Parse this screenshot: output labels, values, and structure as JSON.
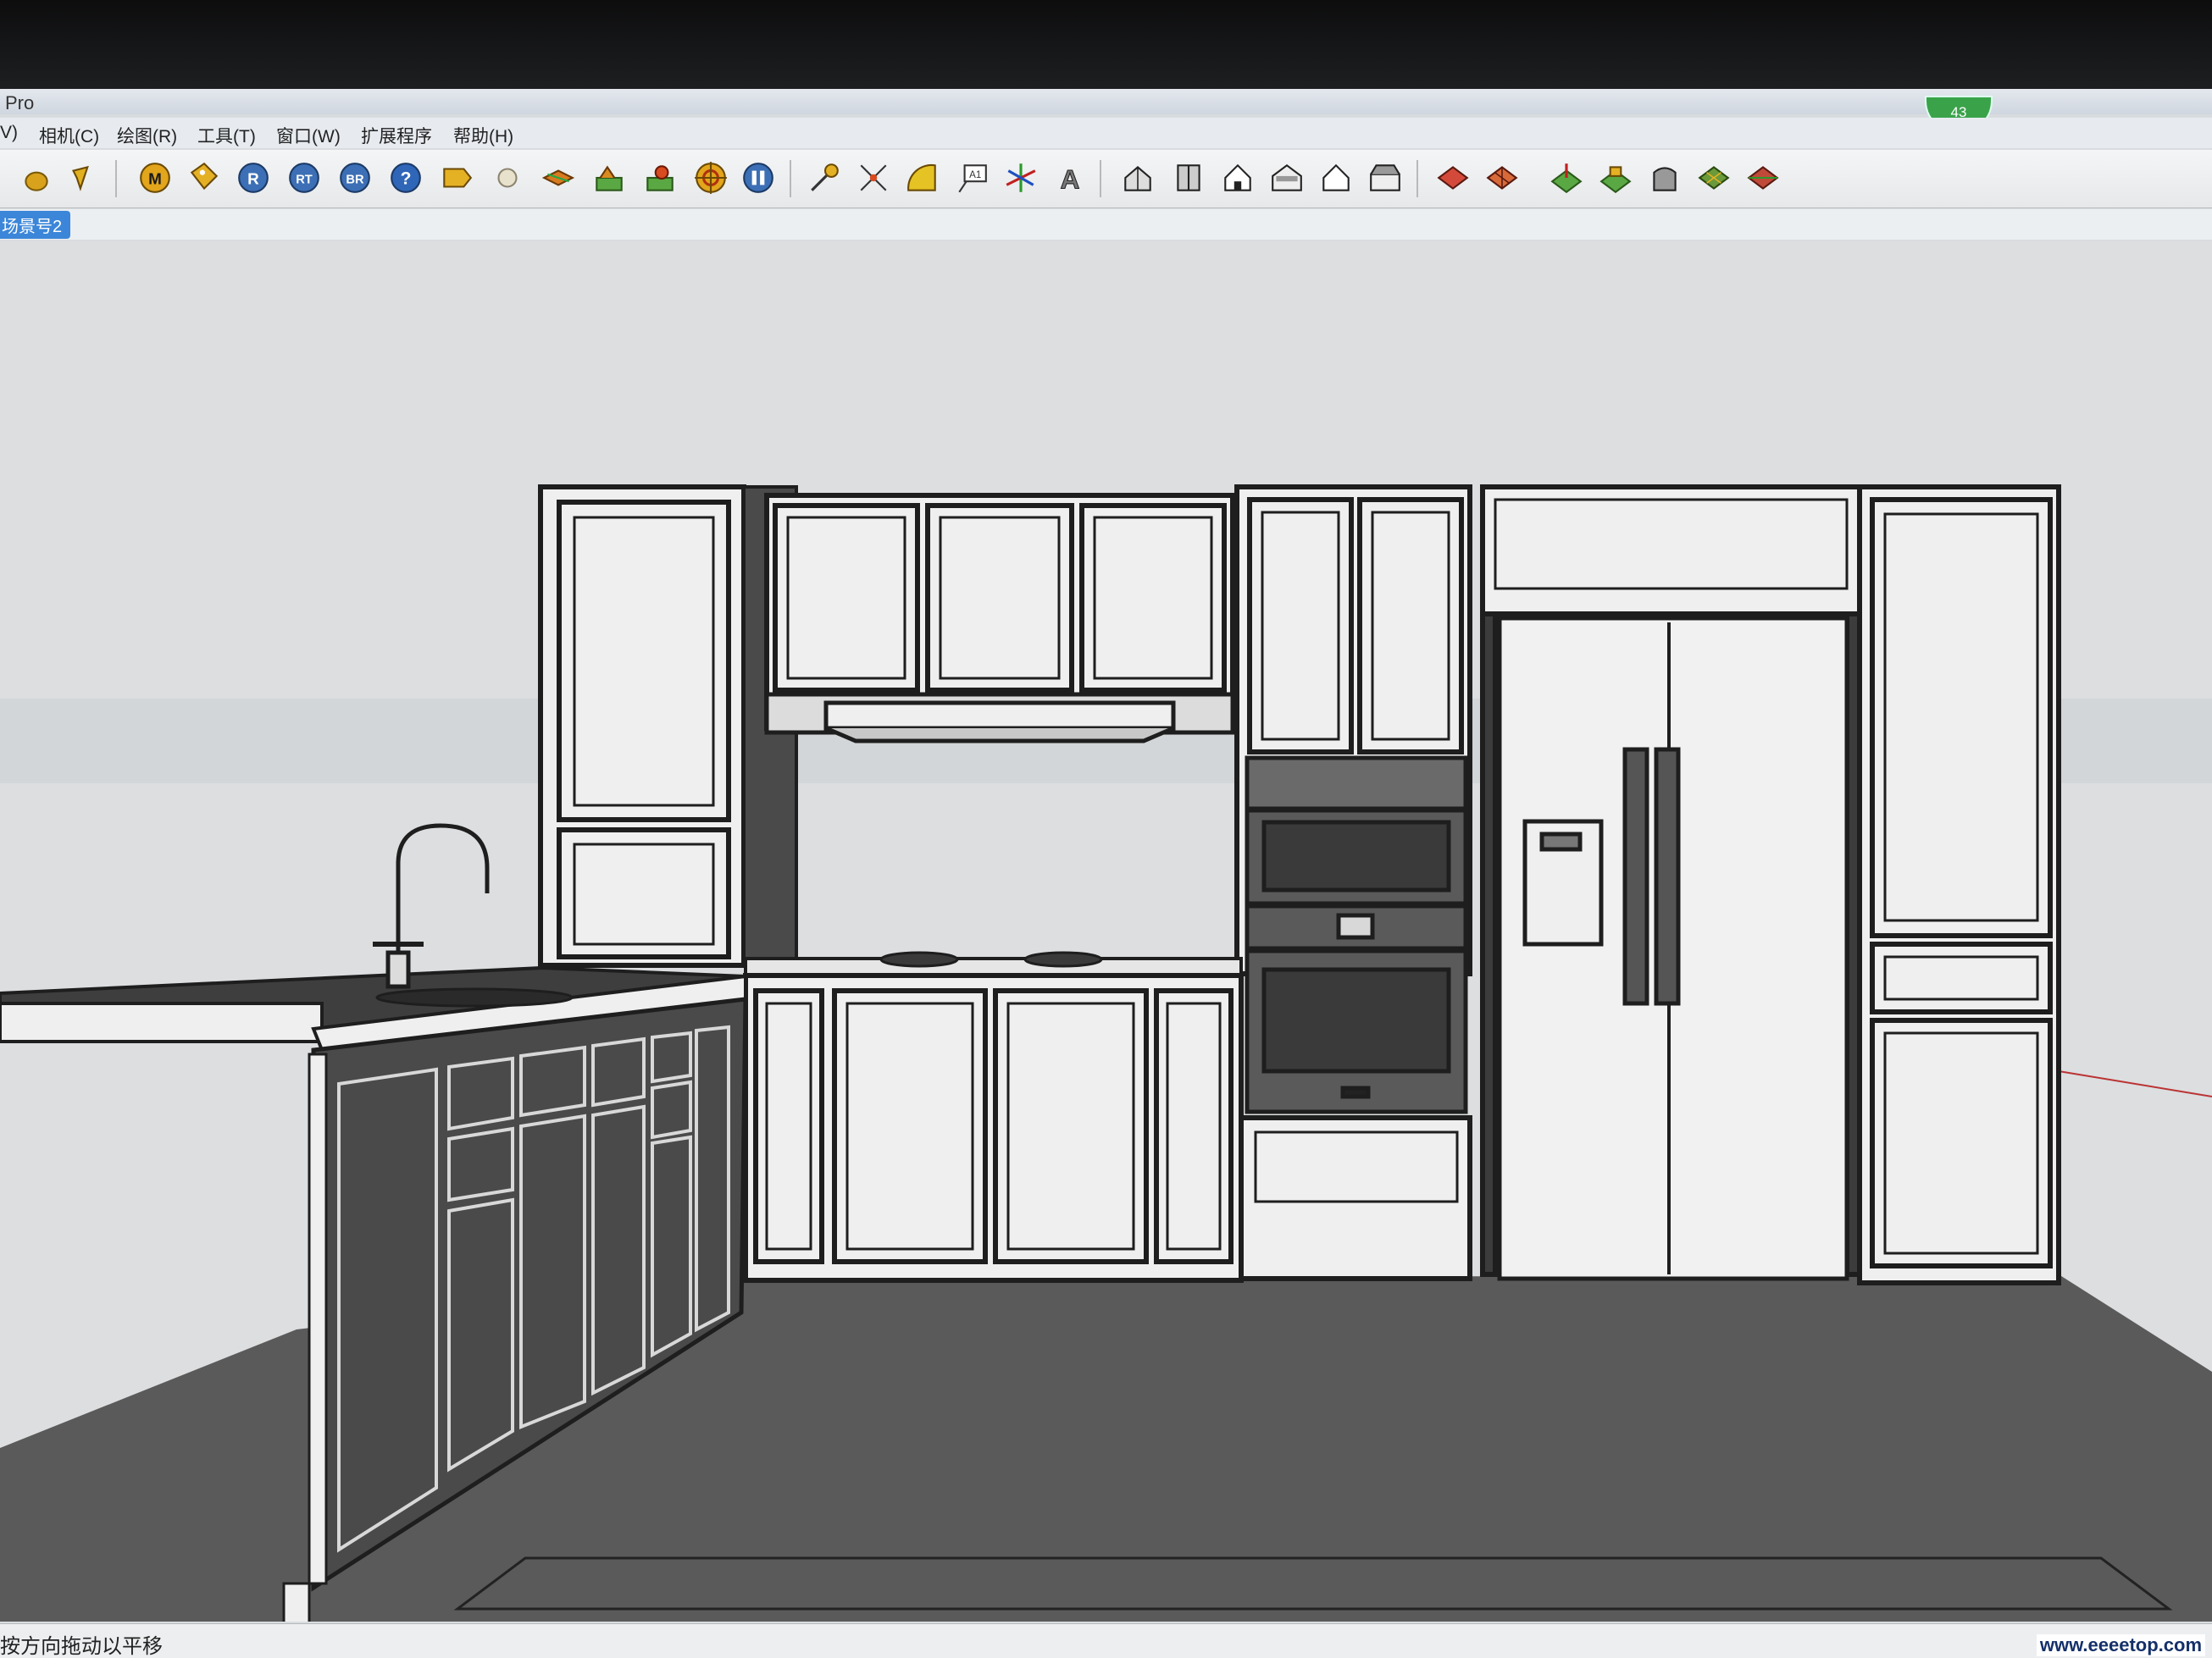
{
  "app": {
    "title_fragment": "Pro",
    "badge_count": "43"
  },
  "menubar": {
    "items": [
      {
        "label": "V)"
      },
      {
        "label": "相机(C)"
      },
      {
        "label": "绘图(R)"
      },
      {
        "label": "工具(T)"
      },
      {
        "label": "窗口(W)"
      },
      {
        "label": "扩展程序"
      },
      {
        "label": "帮助(H)"
      }
    ]
  },
  "toolbar": {
    "tools": [
      {
        "icon": "orb-icon"
      },
      {
        "icon": "paint-brush-icon"
      },
      {
        "icon": "material-m-icon"
      },
      {
        "icon": "tag-icon"
      },
      {
        "icon": "render-r-icon"
      },
      {
        "icon": "render-rt-icon"
      },
      {
        "icon": "batch-render-br-icon"
      },
      {
        "icon": "help-icon"
      },
      {
        "icon": "label-icon"
      },
      {
        "icon": "sphere-icon"
      },
      {
        "icon": "layers-icon"
      },
      {
        "icon": "landscape-icon"
      },
      {
        "icon": "landscape-edit-icon"
      },
      {
        "icon": "target-icon"
      },
      {
        "icon": "pause-icon"
      },
      {
        "icon": "tape-measure-icon"
      },
      {
        "icon": "dimension-icon"
      },
      {
        "icon": "protractor-icon"
      },
      {
        "icon": "text-icon"
      },
      {
        "icon": "axes-icon"
      },
      {
        "icon": "3d-text-icon"
      },
      {
        "icon": "iso-view-icon"
      },
      {
        "icon": "top-view-icon"
      },
      {
        "icon": "front-view-icon"
      },
      {
        "icon": "right-view-icon"
      },
      {
        "icon": "back-view-icon"
      },
      {
        "icon": "left-view-icon"
      },
      {
        "icon": "sandbox-contours-icon"
      },
      {
        "icon": "sandbox-scratch-icon"
      },
      {
        "icon": "sandbox-smoove-icon"
      },
      {
        "icon": "sandbox-stamp-icon"
      },
      {
        "icon": "sandbox-drape-icon"
      },
      {
        "icon": "sandbox-detail-icon"
      },
      {
        "icon": "sandbox-flip-icon"
      }
    ]
  },
  "scene_tab": {
    "label": "场景号2"
  },
  "statusbar": {
    "text": "按方向拖动以平移"
  },
  "watermark": {
    "text": "www.eeeetop.com"
  },
  "colors": {
    "cabinet_fill": "#efefef",
    "cabinet_line": "#1e1e1e",
    "floor": "#5a5a5a",
    "base_dark": "#4a4a4a",
    "countertop": "#3e3e3e"
  }
}
